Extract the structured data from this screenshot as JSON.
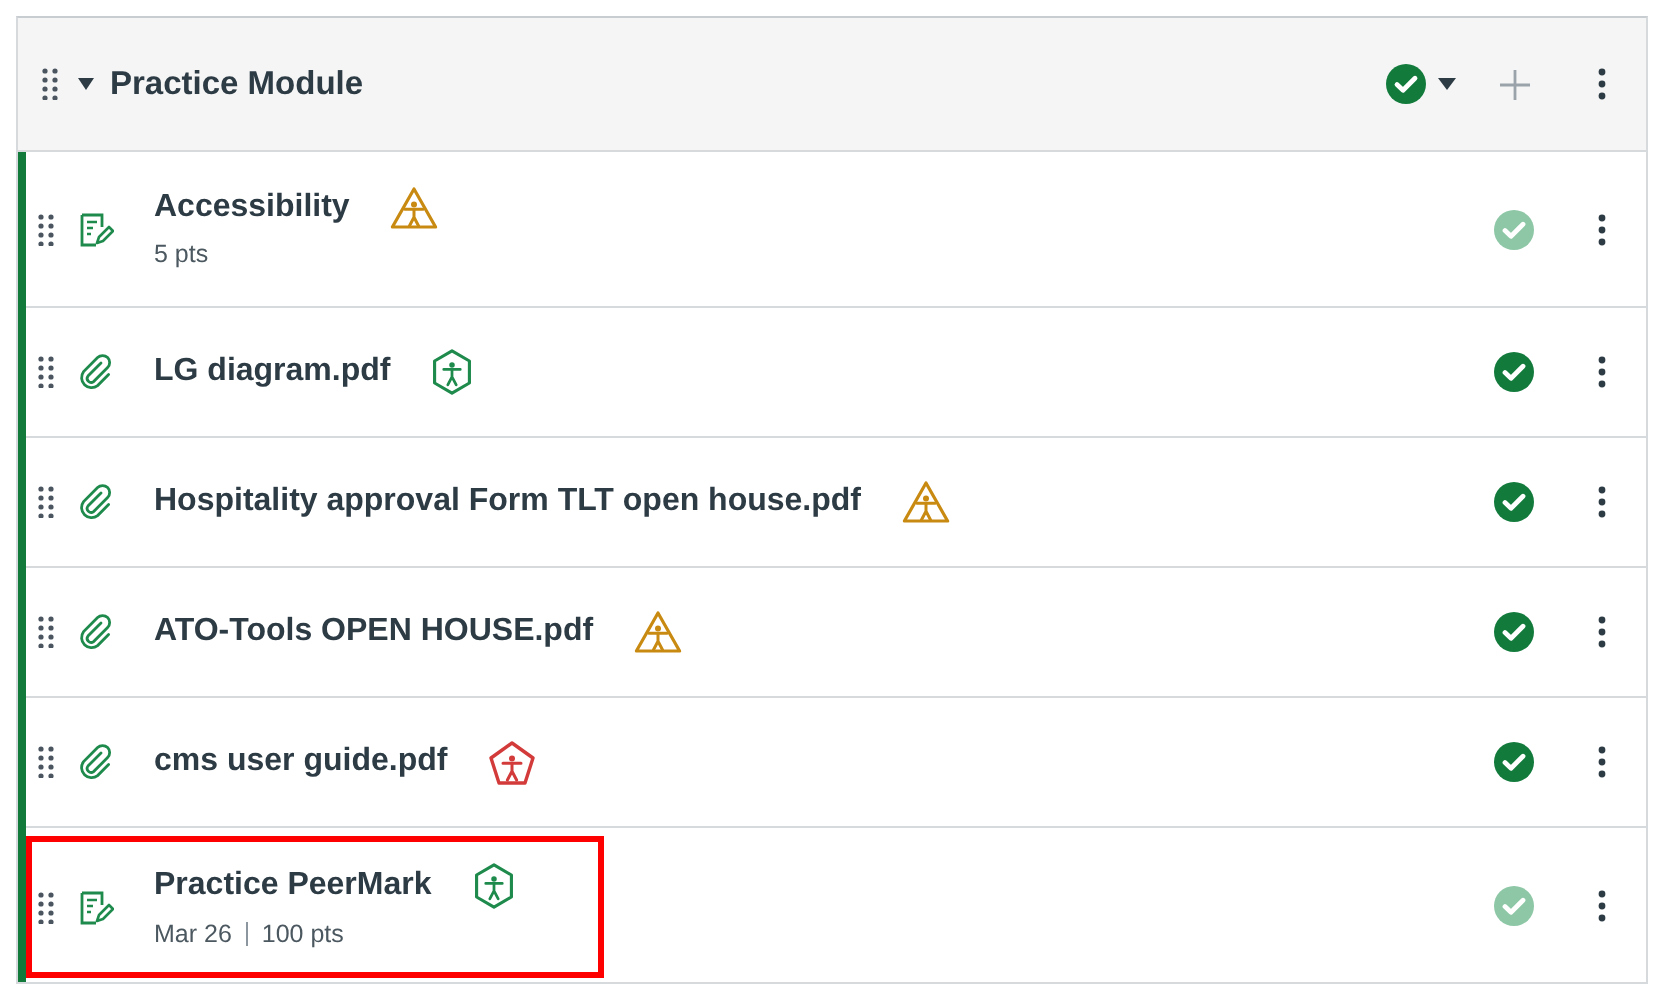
{
  "module": {
    "title": "Practice Module",
    "expanded": true,
    "published": true
  },
  "items": [
    {
      "kind": "assignment",
      "title": "Accessibility",
      "meta": [
        "5 pts"
      ],
      "color": "#c98a12",
      "dimmed": true,
      "highlighted": false
    },
    {
      "kind": "attachment",
      "title": "LG diagram.pdf",
      "color": "#1e8a4c",
      "dimmed": false,
      "highlighted": false
    },
    {
      "kind": "attachment",
      "title": "Hospitality approval Form TLT open house.pdf",
      "color": "#c98a12",
      "dimmed": false,
      "highlighted": false
    },
    {
      "kind": "attachment",
      "title": "ATO-Tools OPEN HOUSE.pdf",
      "color": "#c98a12",
      "dimmed": false,
      "highlighted": false
    },
    {
      "kind": "attachment",
      "title": "cms user guide.pdf",
      "color": "#d33b3b",
      "dimmed": false,
      "highlighted": false
    },
    {
      "kind": "assignment",
      "title": "Practice PeerMark",
      "meta": [
        "Mar 26",
        "100 pts"
      ],
      "color": "#1e8a4c",
      "dimmed": true,
      "highlighted": true
    }
  ]
}
